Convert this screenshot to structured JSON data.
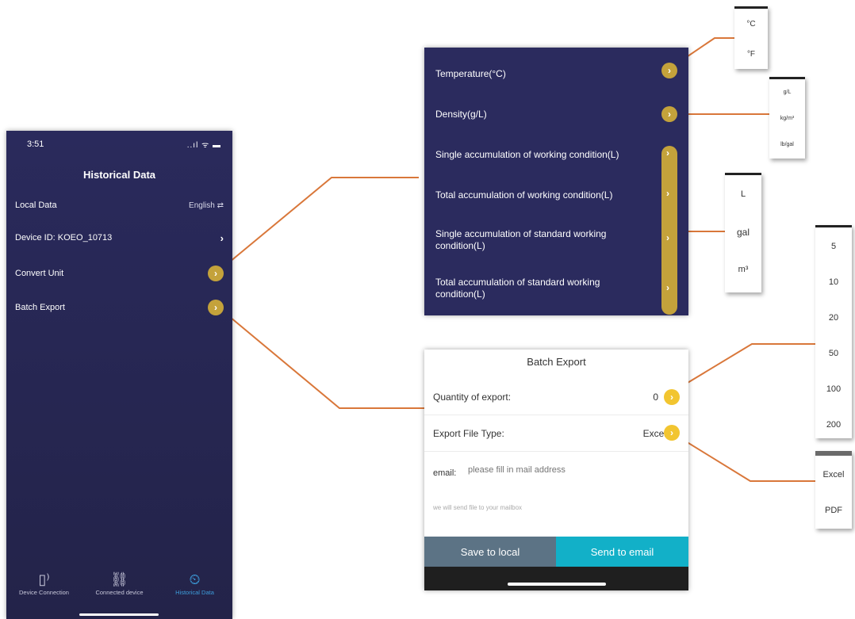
{
  "phone": {
    "status_time": "3:51",
    "status_icons": "..ıl ᯤ ▬",
    "title": "Historical Data",
    "rows": [
      {
        "label": "Local Data",
        "value": "English ⇄"
      },
      {
        "label": "Device ID: KOEO_10713",
        "value": "›"
      },
      {
        "label": "Convert Unit",
        "value": "›"
      },
      {
        "label": "Batch Export",
        "value": "›"
      }
    ],
    "tabs": [
      {
        "label": "Device Connection",
        "icon": "▯⁾"
      },
      {
        "label": "Connected device",
        "icon": "⛓"
      },
      {
        "label": "Historical Data",
        "icon": "⏲"
      }
    ]
  },
  "unit_panel": {
    "rows": [
      {
        "label": "Temperature(°C)"
      },
      {
        "label": "Density(g/L)"
      },
      {
        "label": "Single accumulation of working condition(L)"
      },
      {
        "label": "Total accumulation of working condition(L)"
      },
      {
        "label": "Single accumulation of standard working condition(L)"
      },
      {
        "label": "Total accumulation of standard working condition(L)"
      }
    ],
    "chevron": "›"
  },
  "popups": {
    "temperature": [
      "°C",
      "°F"
    ],
    "density": [
      "g/L",
      "kg/m³",
      "lb/gal"
    ],
    "volume": [
      "L",
      "gal",
      "m³"
    ],
    "quantity": [
      "5",
      "10",
      "20",
      "50",
      "100",
      "200"
    ],
    "filetype": [
      "Excel",
      "PDF"
    ]
  },
  "batch": {
    "title": "Batch Export",
    "quantity_label": "Quantity of export:",
    "quantity_value": "0",
    "filetype_label": "Export File Type:",
    "filetype_value": "Excel",
    "email_label": "email:",
    "email_placeholder": "please fill in mail address",
    "hint": "we will send file to your mailbox",
    "save_label": "Save to local",
    "send_label": "Send to email"
  },
  "colors": {
    "phone_bg": "#2a2a5c",
    "panel_bg": "#2b2b5e",
    "gold": "#c4a23b",
    "yellow": "#f2c530",
    "connector": "#d9773a",
    "save_btn": "#5c7385",
    "send_btn": "#12b0c8",
    "active_tab": "#3d9ddb"
  }
}
